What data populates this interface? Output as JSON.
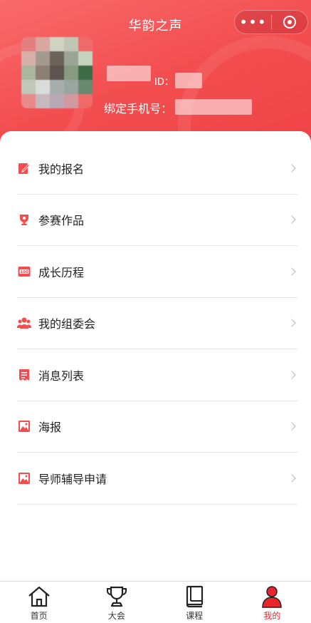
{
  "header": {
    "app_title": "华韵之声",
    "capsule": {
      "more_icon": "more-dots-icon",
      "close_icon": "mini-program-close-icon"
    },
    "profile": {
      "id_label": "ID：",
      "phone_label": "绑定手机号："
    }
  },
  "menu": {
    "items": [
      {
        "label": "我的报名",
        "icon": "signup-pen-icon"
      },
      {
        "label": "参赛作品",
        "icon": "trophy-icon"
      },
      {
        "label": "成长历程",
        "icon": "growth-100-icon"
      },
      {
        "label": "我的组委会",
        "icon": "group-users-icon"
      },
      {
        "label": "消息列表",
        "icon": "message-list-icon"
      },
      {
        "label": "海报",
        "icon": "poster-image-icon"
      },
      {
        "label": "导师辅导申请",
        "icon": "tutor-application-icon"
      }
    ]
  },
  "tabbar": {
    "items": [
      {
        "label": "首页",
        "icon": "home-icon"
      },
      {
        "label": "大会",
        "icon": "trophy-outline-icon"
      },
      {
        "label": "课程",
        "icon": "book-icon"
      },
      {
        "label": "我的",
        "icon": "user-icon",
        "active": true
      }
    ]
  },
  "colors": {
    "brand": "#f24d4f",
    "active_tab": "#e8242c"
  }
}
